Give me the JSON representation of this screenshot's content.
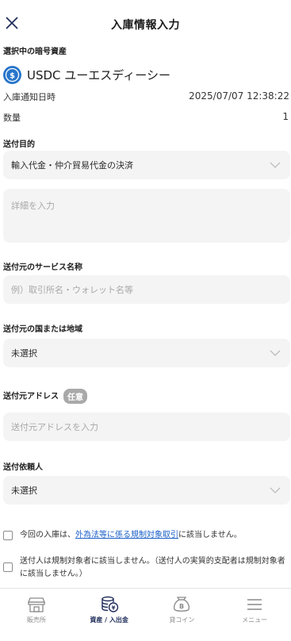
{
  "header": {
    "title": "入庫情報入力",
    "close_icon": "close-icon"
  },
  "asset": {
    "label": "選択中の暗号資産",
    "name": "USDC ユーエスディーシー",
    "coin_icon": "usdc-coin-icon",
    "coin_color": "#2775ca"
  },
  "info": [
    {
      "label": "入庫通知日時",
      "value": "2025/07/07 12:38:22"
    },
    {
      "label": "数量",
      "value": "1"
    }
  ],
  "purpose": {
    "label": "送付目的",
    "value": "輸入代金・仲介貿易代金の決済",
    "detail_placeholder": "詳細を入力"
  },
  "service": {
    "label": "送付元のサービス名称",
    "placeholder": "例）取引所名・ウォレット名等"
  },
  "country": {
    "label": "送付元の国または地域",
    "value": "未選択"
  },
  "address": {
    "label": "送付元アドレス",
    "badge": "任意",
    "placeholder": "送付元アドレスを入力"
  },
  "requester": {
    "label": "送付依頼人",
    "value": "未選択"
  },
  "checks": {
    "first_prefix": "今回の入庫は、",
    "first_link": "外為法等に係る規制対象取引",
    "first_suffix": "に該当しません。",
    "second": "送付人は規制対象者に該当しません。（送付人の実質的支配者は規制対象者に該当しません。）"
  },
  "nav": [
    {
      "label": "販売所",
      "icon": "store-icon",
      "active": false
    },
    {
      "label": "資産 / 入出金",
      "icon": "coins-deposit-icon",
      "active": true
    },
    {
      "label": "貸コイン",
      "icon": "lend-coin-icon",
      "active": false
    },
    {
      "label": "メニュー",
      "icon": "hamburger-menu-icon",
      "active": false
    }
  ],
  "colors": {
    "accent": "#1f2d5a",
    "link": "#1a5fc8",
    "field_bg": "#f4f4f4",
    "badge_bg": "#a9a9a9"
  }
}
